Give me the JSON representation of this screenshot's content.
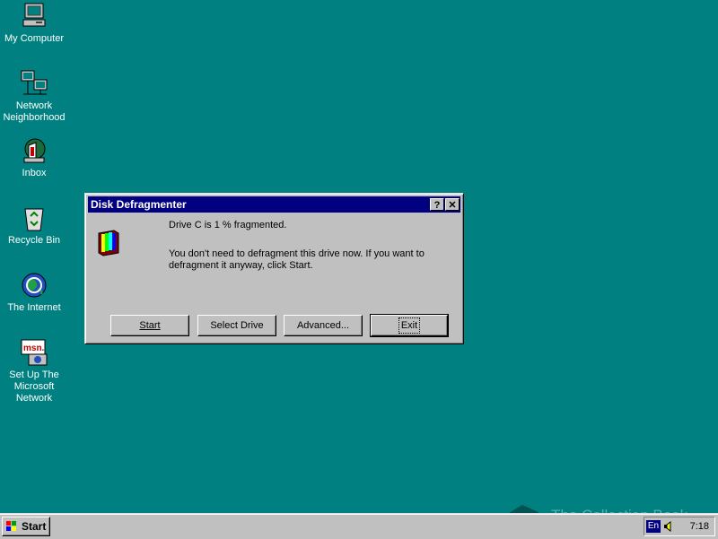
{
  "desktop": {
    "icons": [
      {
        "label": "My Computer"
      },
      {
        "label": "Network Neighborhood"
      },
      {
        "label": "Inbox"
      },
      {
        "label": "Recycle Bin"
      },
      {
        "label": "The Internet"
      },
      {
        "label": "Set Up The Microsoft Network"
      }
    ]
  },
  "dialog": {
    "title": "Disk Defragmenter",
    "help_button": "?",
    "close_button": "✕",
    "status_line": "Drive C is 1 % fragmented.",
    "message_line1": "You don't need to defragment this drive now. If you want to",
    "message_line2": "defragment it anyway, click Start.",
    "buttons": {
      "start": "Start",
      "select_drive": "Select Drive",
      "advanced": "Advanced...",
      "exit": "Exit"
    }
  },
  "taskbar": {
    "start_label": "Start",
    "language": "En",
    "clock": "7:18"
  },
  "watermark": {
    "text": "The Collection Book"
  },
  "colors": {
    "desktop": "#008080",
    "title_bar": "#000080",
    "face": "#c0c0c0"
  }
}
